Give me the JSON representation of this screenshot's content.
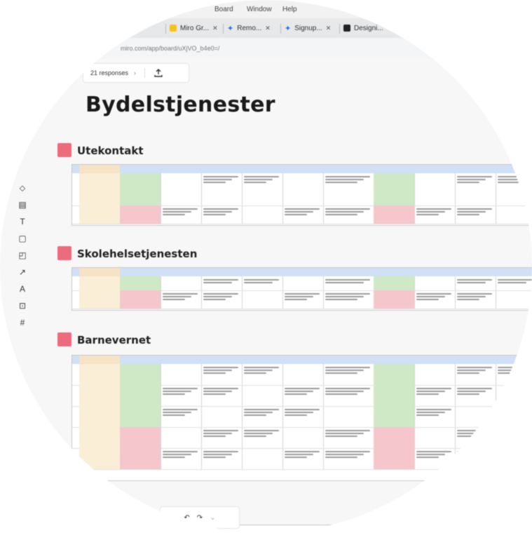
{
  "menubar": {
    "items": [
      "Board",
      "Window",
      "Help"
    ]
  },
  "tabs": [
    {
      "label": "Miro Gr...",
      "icon": "miro-icon",
      "color": "#f7c21a"
    },
    {
      "label": "Remo...",
      "icon": "star-icon",
      "color": "#2a6fdb"
    },
    {
      "label": "Signup...",
      "icon": "star-icon",
      "color": "#2a6fdb"
    },
    {
      "label": "Designi...",
      "icon": "app-icon",
      "color": "#222222"
    }
  ],
  "address": {
    "url": "miro.com/app/board/uXjVO_b4e0=/"
  },
  "responses": {
    "label": "21 responses"
  },
  "page": {
    "title": "Bydelstjenester"
  },
  "sections": [
    {
      "title": "Utekontakt"
    },
    {
      "title": "Skolehelsetjenesten"
    },
    {
      "title": "Barnevernet"
    }
  ],
  "colors": {
    "section_accent": "#ec6b7c",
    "header_blue": "#cfe0f7",
    "col_green": "#cfe8c5",
    "col_red": "#f5c7cd",
    "col_yellow": "#faefd6"
  },
  "toolbar": {
    "tools": [
      "select-icon",
      "sticky-note-icon",
      "text-icon",
      "shape-icon",
      "comment-icon",
      "pen-icon",
      "template-icon",
      "frame-icon",
      "grid-icon"
    ]
  },
  "zoombar": {
    "icons": [
      "undo-icon",
      "redo-icon",
      "more-icon"
    ]
  }
}
